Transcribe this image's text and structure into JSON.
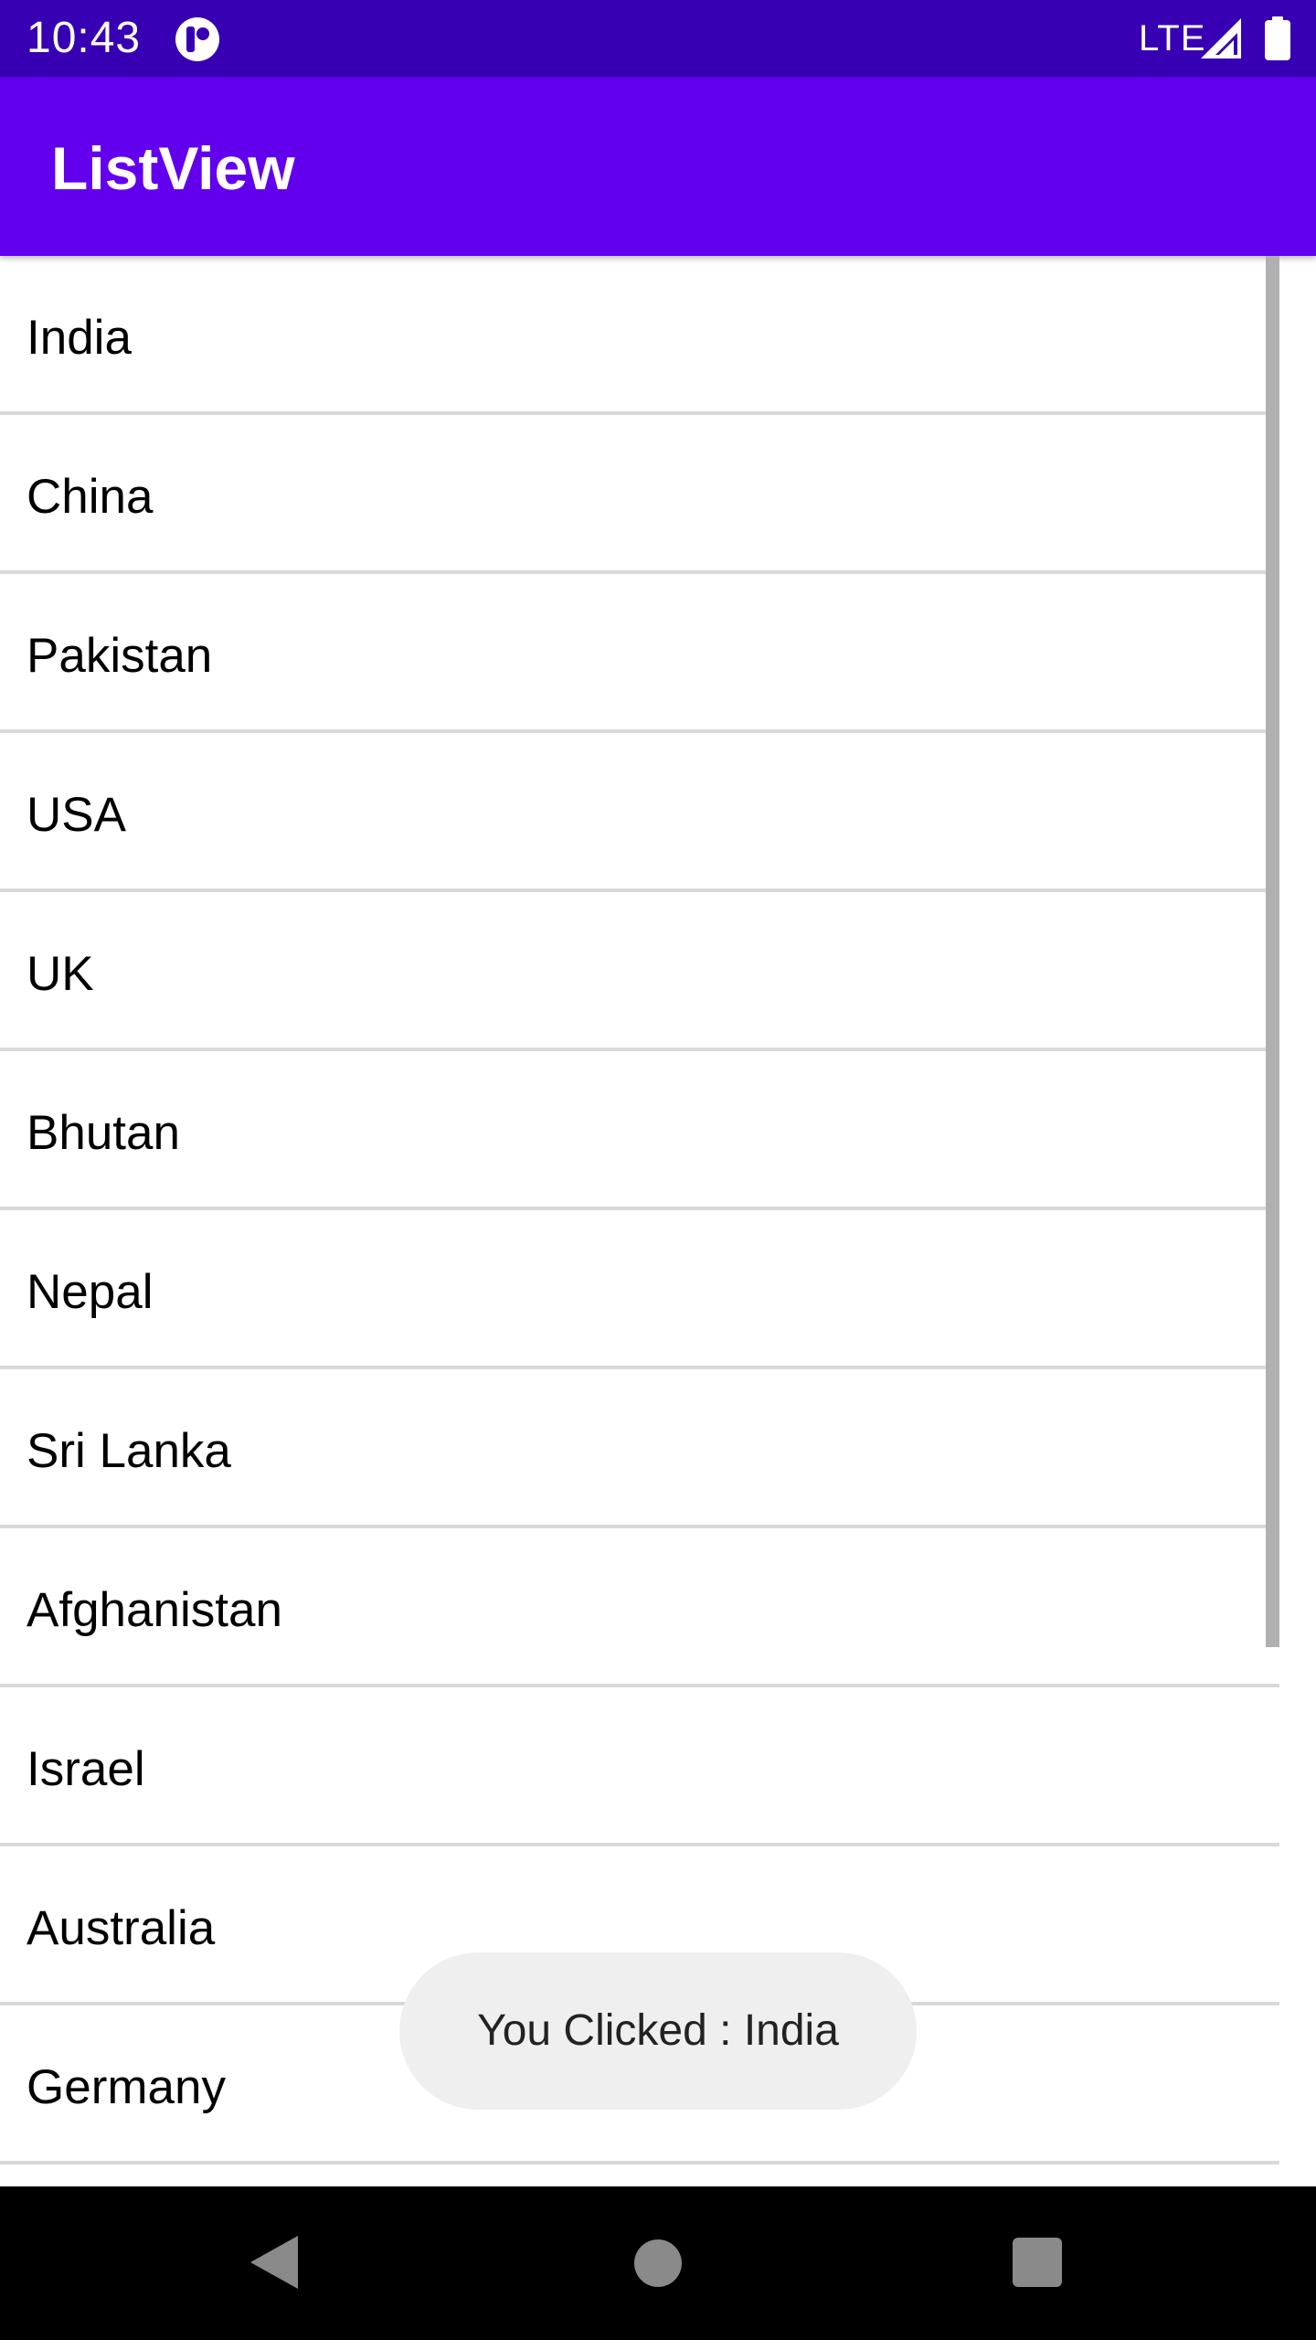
{
  "status_bar": {
    "time": "10:43",
    "network": "LTE",
    "app_icon": "notification-app-icon",
    "signal_icon": "signal-icon",
    "battery_icon": "battery-icon"
  },
  "app_bar": {
    "title": "ListView"
  },
  "list": {
    "items": [
      {
        "label": "India"
      },
      {
        "label": "China"
      },
      {
        "label": "Pakistan"
      },
      {
        "label": "USA"
      },
      {
        "label": "UK"
      },
      {
        "label": "Bhutan"
      },
      {
        "label": "Nepal"
      },
      {
        "label": "Sri Lanka"
      },
      {
        "label": "Afghanistan"
      },
      {
        "label": "Israel"
      },
      {
        "label": "Australia"
      },
      {
        "label": "Germany"
      },
      {
        "label": ""
      }
    ]
  },
  "toast": {
    "text": "You Clicked : India"
  },
  "nav_bar": {
    "back_icon": "back-icon",
    "home_icon": "home-icon",
    "recents_icon": "recents-icon"
  },
  "colors": {
    "status_bar": "#3700b3",
    "app_bar": "#6200ee",
    "divider": "#d9d9d9",
    "toast_bg": "#efefef",
    "nav_bar": "#000000"
  }
}
